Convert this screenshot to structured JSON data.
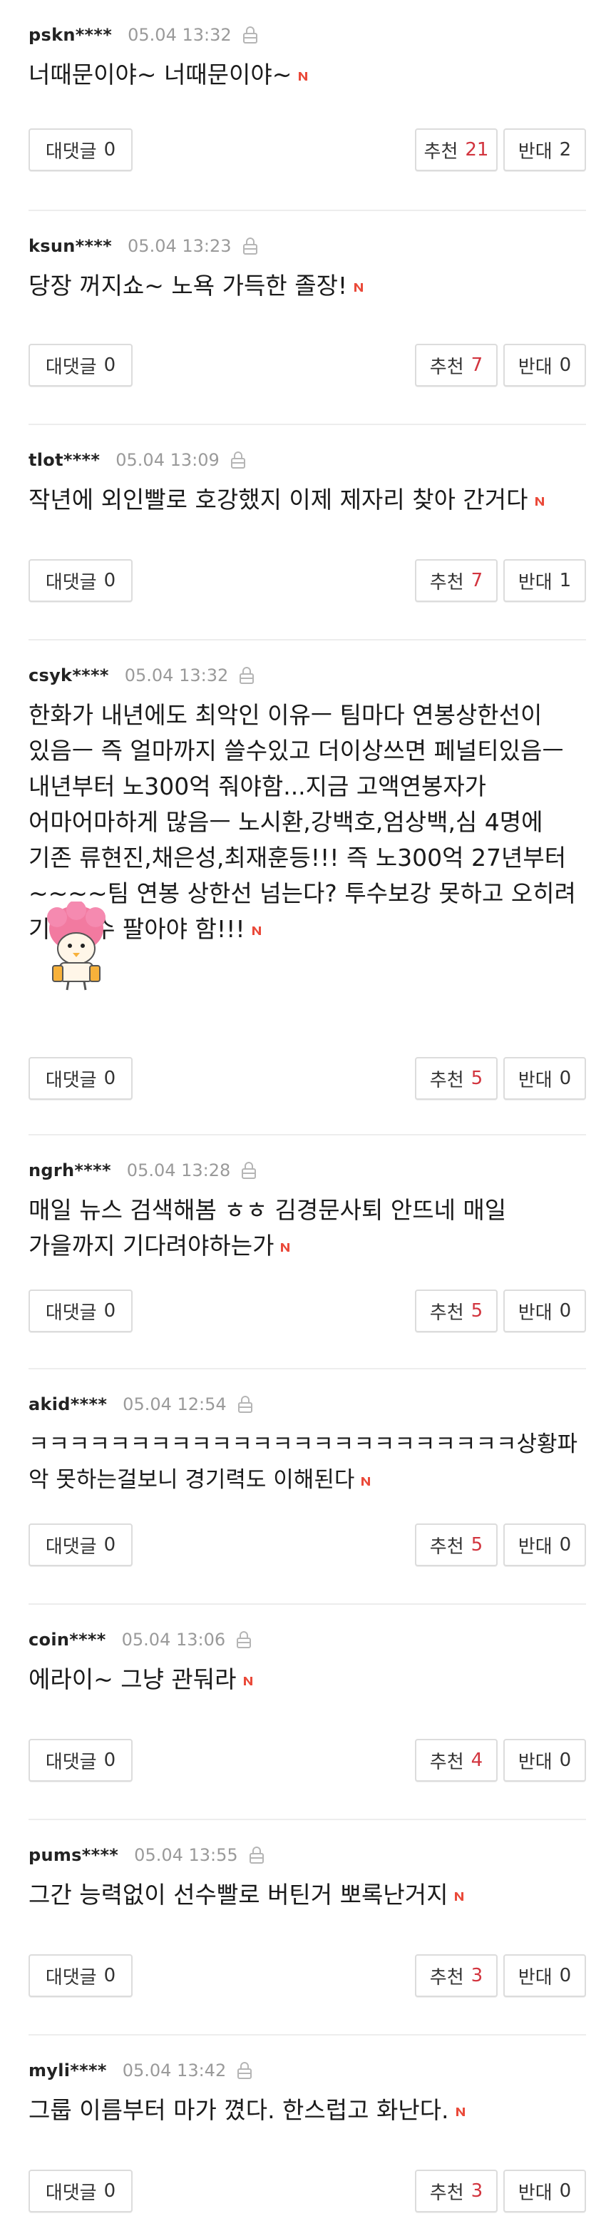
{
  "labels": {
    "reply": "대댓글",
    "up": "추천",
    "down": "반대"
  },
  "colors": {
    "accent": "#d2343e",
    "badge": "#ea4a3a",
    "meta": "#9a9a9a"
  },
  "icons": {
    "lock": "lock-icon",
    "new_badge": "n-badge-icon",
    "sticker": "pink-character-sticker"
  },
  "comments": [
    {
      "nick": "pskn****",
      "date": "05.04 13:32",
      "text": "너때문이야~ 너때문이야~",
      "replies": "0",
      "up": "21",
      "down": "2"
    },
    {
      "nick": "ksun****",
      "date": "05.04 13:23",
      "text": "당장 꺼지쇼~ 노욕 가득한 졸장!",
      "replies": "0",
      "up": "7",
      "down": "0"
    },
    {
      "nick": "tlot****",
      "date": "05.04 13:09",
      "text": "작년에 외인빨로 호강했지 이제 제자리 찾아 간거다",
      "replies": "0",
      "up": "7",
      "down": "1"
    },
    {
      "nick": "csyk****",
      "date": "05.04 13:32",
      "text": "한화가 내년에도 최악인 이유ㅡ 팀마다 연봉상한선이 있음ㅡ 즉 얼마까지 쓸수있고 더이상쓰면 페널티있음ㅡ 내년부터 노300억 줘야함...지금 고액연봉자가 어마어마하게 많음ㅡ 노시환,강백호,엄상백,심 4명에 기존 류현진,채은성,최재훈등!!! 즉 노300억 27년부터~~~~팀 연봉 상한선 넘는다? 투수보강 못하고 오히려 기존선수 팔아야 함!!!",
      "replies": "0",
      "up": "5",
      "down": "0"
    },
    {
      "nick": "ngrh****",
      "date": "05.04 13:28",
      "text": "매일 뉴스 검색해봄 ㅎㅎ 김경문사퇴 안뜨네 매일 가을까지 기다려야하는가",
      "replies": "0",
      "up": "5",
      "down": "0"
    },
    {
      "nick": "akid****",
      "date": "05.04 12:54",
      "text": "ㅋㅋㅋㅋㅋㅋㅋㅋㅋㅋㅋㅋㅋㅋㅋㅋㅋㅋㅋㅋㅋㅋㅋㅋ상황파악 못하는걸보니 경기력도 이해된다",
      "replies": "0",
      "up": "5",
      "down": "0"
    },
    {
      "nick": "coin****",
      "date": "05.04 13:06",
      "text": "에라이~ 그냥 관둬라",
      "replies": "0",
      "up": "4",
      "down": "0"
    },
    {
      "nick": "pums****",
      "date": "05.04 13:55",
      "text": "그간 능력없이 선수빨로 버틴거 뽀록난거지",
      "replies": "0",
      "up": "3",
      "down": "0"
    },
    {
      "nick": "myli****",
      "date": "05.04 13:42",
      "text": "그룹 이름부터 마가 꼈다. 한스럽고 화난다.",
      "replies": "0",
      "up": "3",
      "down": "0"
    }
  ]
}
